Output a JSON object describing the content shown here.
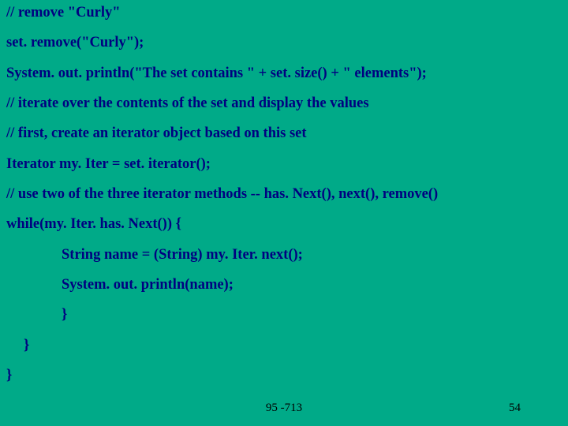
{
  "lines": {
    "l1": "// remove \"Curly\"",
    "l2": "set. remove(\"Curly\");",
    "l3": "System. out. println(\"The set contains \" + set. size() + \" elements\");",
    "l4": "// iterate over the contents of the set and display the values",
    "l5": "// first, create an iterator object based on this set",
    "l6": "Iterator my. Iter = set. iterator();",
    "l7": "// use two of the three iterator methods -- has. Next(), next(), remove()",
    "l8": "while(my. Iter. has. Next()) {",
    "l9": "String name = (String) my. Iter. next();",
    "l10": "System. out. println(name);",
    "l11": "}",
    "l12": "}",
    "l13": "}"
  },
  "footer": {
    "center": "95 -713",
    "right": "54"
  }
}
